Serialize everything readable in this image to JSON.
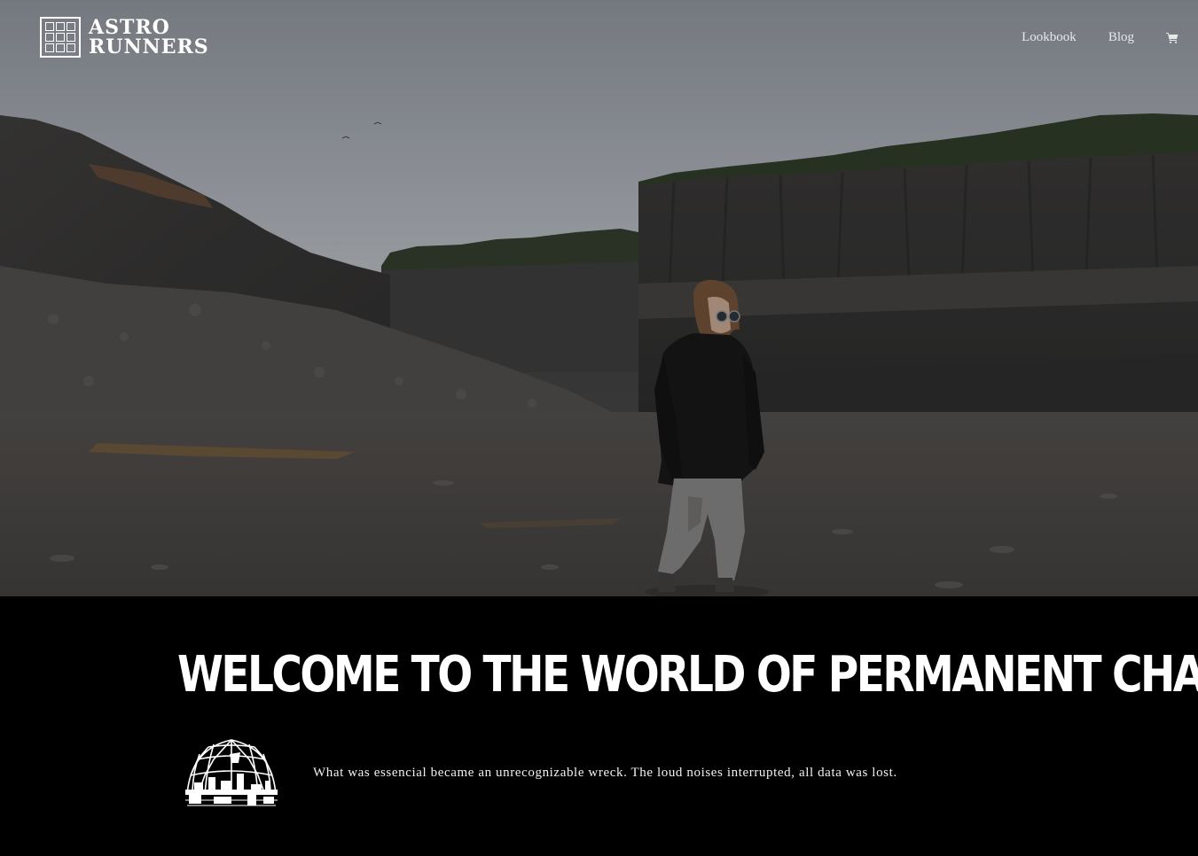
{
  "brand": {
    "line1": "ASTRO",
    "line2": "RUNNERS",
    "logo_icon": "grid-window-icon"
  },
  "nav": {
    "items": [
      {
        "label": "Lookbook"
      },
      {
        "label": "Blog"
      }
    ],
    "cart_icon": "shopping-cart-icon"
  },
  "hero": {
    "image": "woman-in-sunglasses-standing-in-rock-quarry"
  },
  "content": {
    "headline": "Welcome to the world of permanent change",
    "feature_icon": "geodesic-dome-icon",
    "intro": "What was essencial became an unrecognizable wreck. The loud noises interrupted, all data was lost."
  },
  "colors": {
    "background": "#000000",
    "text": "#ffffff",
    "nav_text": "#e8e8e8"
  }
}
